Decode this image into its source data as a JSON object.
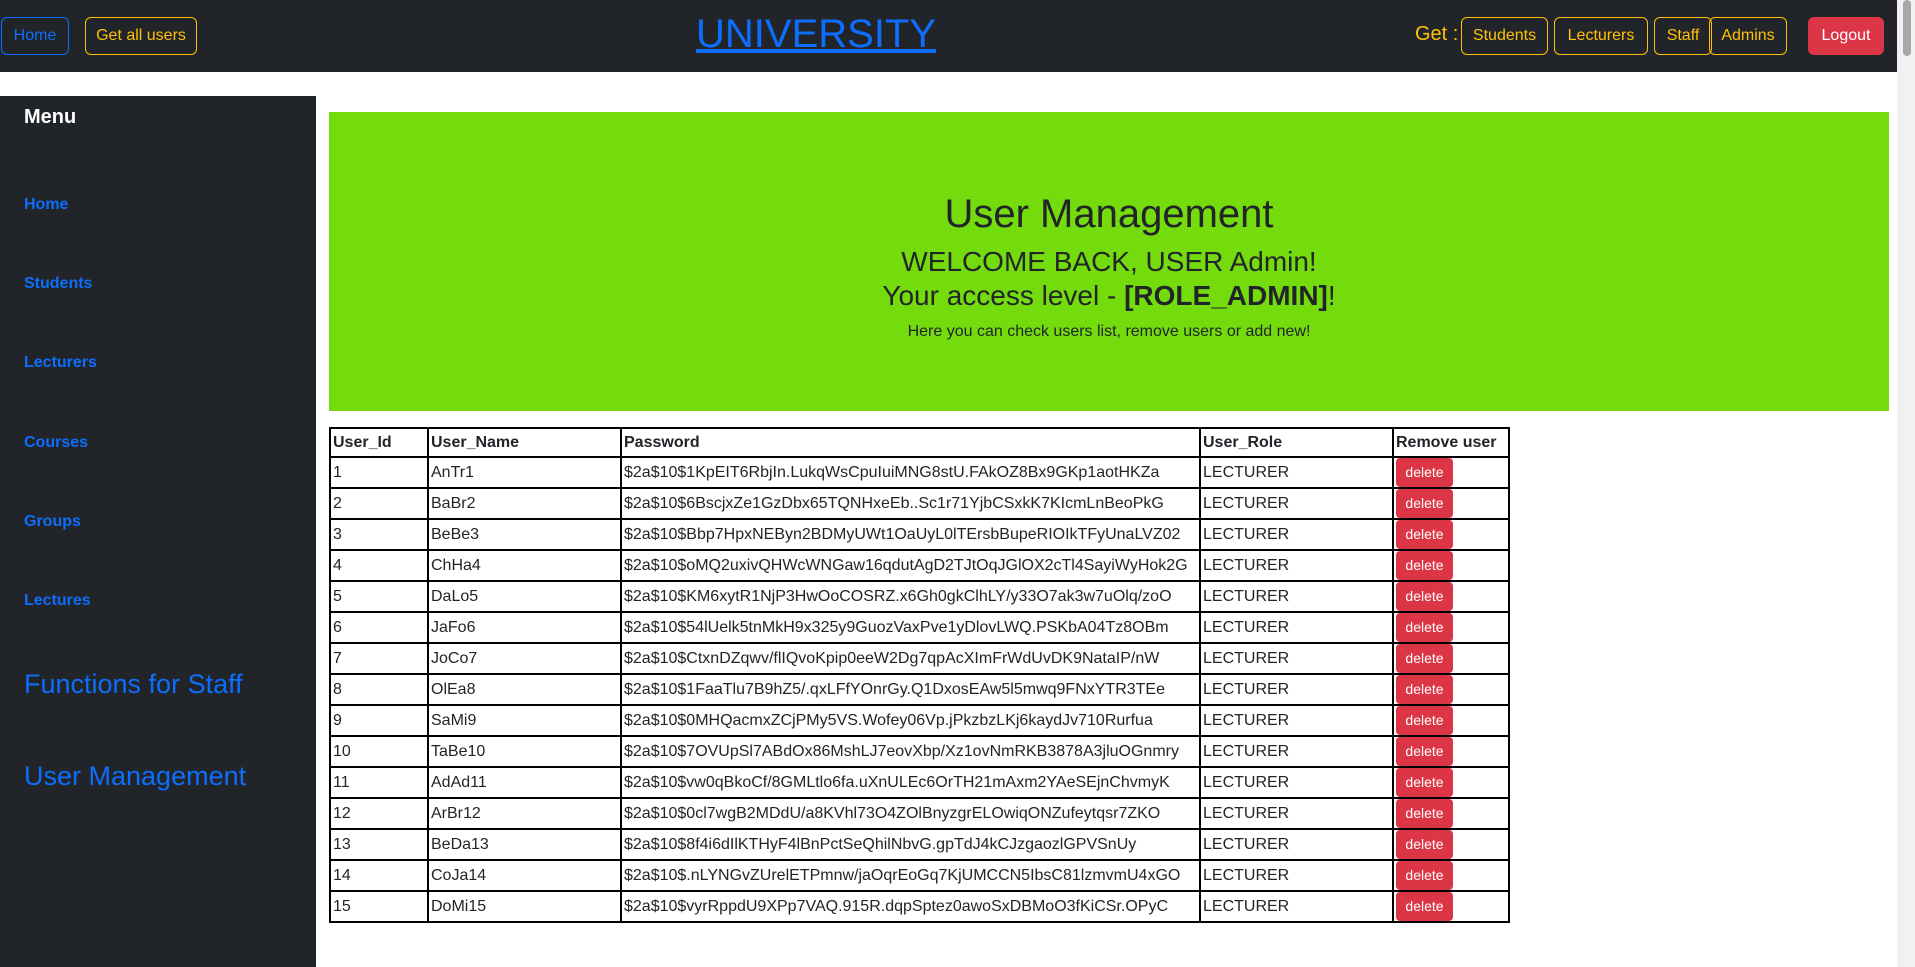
{
  "navbar": {
    "home_label": "Home",
    "get_all_users_label": "Get all users",
    "brand": "UNIVERSITY",
    "get_label": "Get :",
    "students_label": "Students",
    "lecturers_label": "Lecturers",
    "staff_label": "Staff",
    "admins_label": "Admins",
    "logout_label": "Logout"
  },
  "sidebar": {
    "title": "Menu",
    "items": [
      "Home",
      "Students",
      "Lecturers",
      "Courses",
      "Groups",
      "Lectures"
    ],
    "big_items": [
      "Functions for Staff",
      "User Management"
    ]
  },
  "hero": {
    "title": "User Management",
    "welcome": "WELCOME BACK, USER Admin!",
    "access_prefix": "Your access level - ",
    "access_role": "[ROLE_ADMIN]",
    "access_suffix": "!",
    "note": "Here you can check users list, remove users or add new!"
  },
  "table": {
    "headers": [
      "User_Id",
      "User_Name",
      "Password",
      "User_Role",
      "Remove user"
    ],
    "delete_label": "delete",
    "rows": [
      {
        "id": "1",
        "name": "AnTr1",
        "password": "$2a$10$1KpEIT6RbjIn.LukqWsCpuIuiMNG8stU.FAkOZ8Bx9GKp1aotHKZa",
        "role": "LECTURER"
      },
      {
        "id": "2",
        "name": "BaBr2",
        "password": "$2a$10$6BscjxZe1GzDbx65TQNHxeEb..Sc1r71YjbCSxkK7KIcmLnBeoPkG",
        "role": "LECTURER"
      },
      {
        "id": "3",
        "name": "BeBe3",
        "password": "$2a$10$Bbp7HpxNEByn2BDMyUWt1OaUyL0lTErsbBupeRIOIkTFyUnaLVZ02",
        "role": "LECTURER"
      },
      {
        "id": "4",
        "name": "ChHa4",
        "password": "$2a$10$oMQ2uxivQHWcWNGaw16qdutAgD2TJtOqJGlOX2cTl4SayiWyHok2G",
        "role": "LECTURER"
      },
      {
        "id": "5",
        "name": "DaLo5",
        "password": "$2a$10$KM6xytR1NjP3HwOoCOSRZ.x6Gh0gkClhLY/y33O7ak3w7uOlq/zoO",
        "role": "LECTURER"
      },
      {
        "id": "6",
        "name": "JaFo6",
        "password": "$2a$10$54lUelk5tnMkH9x325y9GuozVaxPve1yDlovLWQ.PSKbA04Tz8OBm",
        "role": "LECTURER"
      },
      {
        "id": "7",
        "name": "JoCo7",
        "password": "$2a$10$CtxnDZqwv/flIQvoKpip0eeW2Dg7qpAcXImFrWdUvDK9NataIP/nW",
        "role": "LECTURER"
      },
      {
        "id": "8",
        "name": "OlEa8",
        "password": "$2a$10$1FaaTlu7B9hZ5/.qxLFfYOnrGy.Q1DxosEAw5l5mwq9FNxYTR3TEe",
        "role": "LECTURER"
      },
      {
        "id": "9",
        "name": "SaMi9",
        "password": "$2a$10$0MHQacmxZCjPMy5VS.Wofey06Vp.jPkzbzLKj6kaydJv710Rurfua",
        "role": "LECTURER"
      },
      {
        "id": "10",
        "name": "TaBe10",
        "password": "$2a$10$7OVUpSl7ABdOx86MshLJ7eovXbp/Xz1ovNmRKB3878A3jluOGnmry",
        "role": "LECTURER"
      },
      {
        "id": "11",
        "name": "AdAd11",
        "password": "$2a$10$vw0qBkoCf/8GMLtlo6fa.uXnULEc6OrTH21mAxm2YAeSEjnChvmyK",
        "role": "LECTURER"
      },
      {
        "id": "12",
        "name": "ArBr12",
        "password": "$2a$10$0cl7wgB2MDdU/a8KVhl73O4ZOlBnyzgrELOwiqONZufeytqsr7ZKO",
        "role": "LECTURER"
      },
      {
        "id": "13",
        "name": "BeDa13",
        "password": "$2a$10$8f4i6dIlKTHyF4lBnPctSeQhilNbvG.gpTdJ4kCJzgaozlGPVSnUy",
        "role": "LECTURER"
      },
      {
        "id": "14",
        "name": "CoJa14",
        "password": "$2a$10$.nLYNGvZUrelETPmnw/jaOqrEoGq7KjUMCCN5IbsC81lzmvmU4xGO",
        "role": "LECTURER"
      },
      {
        "id": "15",
        "name": "DoMi15",
        "password": "$2a$10$vyrRppdU9XPp7VAQ.915R.dqpSptez0awoSxDBMoO3fKiCSr.OPyC",
        "role": "LECTURER"
      }
    ]
  },
  "colors": {
    "navbar_bg": "#212529",
    "hero_bg": "#74dc0c",
    "link_blue": "#0d6efd",
    "warning_yellow": "#ffc107",
    "danger_red": "#dc3545"
  }
}
